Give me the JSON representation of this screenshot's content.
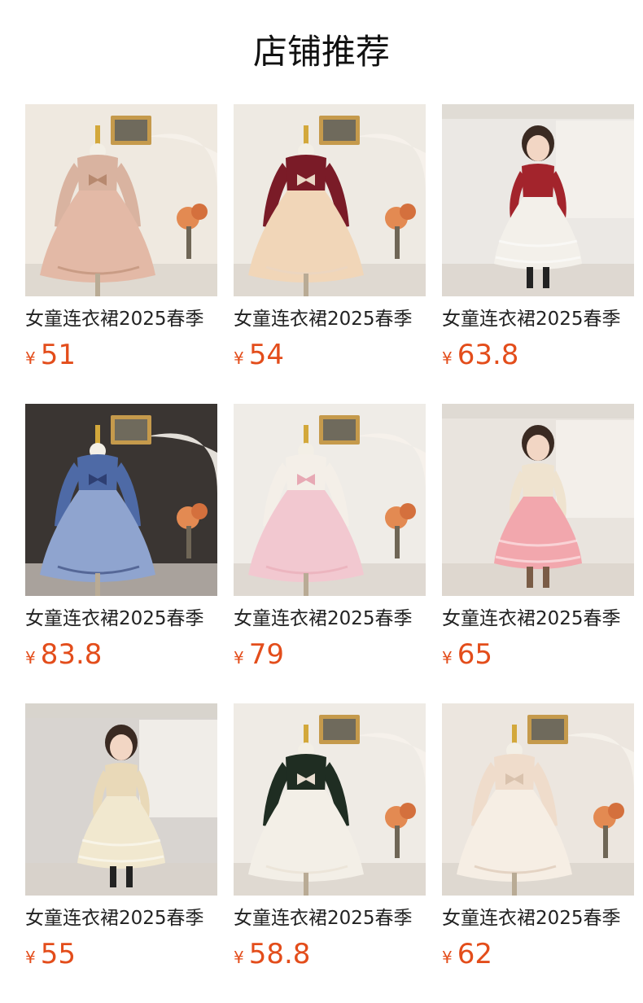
{
  "header": {
    "title": "店铺推荐"
  },
  "products": [
    {
      "name": "女童连衣裙2025春季",
      "currency": "¥",
      "price": "51",
      "scene": "mannequin",
      "bg": "#efe9e0",
      "dress": "#e3b9a6",
      "top": "#d9b3a0",
      "accent": "#b7896f"
    },
    {
      "name": "女童连衣裙2025春季",
      "currency": "¥",
      "price": "54",
      "scene": "mannequin",
      "bg": "#eeeae3",
      "dress": "#f1d6b8",
      "top": "#7a1b27",
      "accent": "#e9d6c4"
    },
    {
      "name": "女童连衣裙2025春季",
      "currency": "¥",
      "price": "63.8",
      "scene": "child",
      "bg": "#ebe8e4",
      "dress": "#f3f0ea",
      "top": "#a3242c",
      "accent": "#222222"
    },
    {
      "name": "女童连衣裙2025春季",
      "currency": "¥",
      "price": "83.8",
      "scene": "mannequin",
      "bg": "#3a3532",
      "dress": "#8fa4cf",
      "top": "#4e6aa6",
      "accent": "#2e3f72"
    },
    {
      "name": "女童连衣裙2025春季",
      "currency": "¥",
      "price": "79",
      "scene": "mannequin",
      "bg": "#efece7",
      "dress": "#f2c8d0",
      "top": "#f4efe8",
      "accent": "#e7a9b4"
    },
    {
      "name": "女童连衣裙2025春季",
      "currency": "¥",
      "price": "65",
      "scene": "child",
      "bg": "#e9e4de",
      "dress": "#f2a7ad",
      "top": "#efe3cf",
      "accent": "#7a5c46"
    },
    {
      "name": "女童连衣裙2025春季",
      "currency": "¥",
      "price": "55",
      "scene": "child",
      "bg": "#d8d4d0",
      "dress": "#f1e8cf",
      "top": "#e9d9b8",
      "accent": "#222222"
    },
    {
      "name": "女童连衣裙2025春季",
      "currency": "¥",
      "price": "58.8",
      "scene": "mannequin",
      "bg": "#efebe5",
      "dress": "#f3efe7",
      "top": "#1f2d22",
      "accent": "#e8ddd0"
    },
    {
      "name": "女童连衣裙2025春季",
      "currency": "¥",
      "price": "62",
      "scene": "mannequin",
      "bg": "#ece6df",
      "dress": "#f6eee4",
      "top": "#efdccb",
      "accent": "#d9c2ad"
    }
  ]
}
